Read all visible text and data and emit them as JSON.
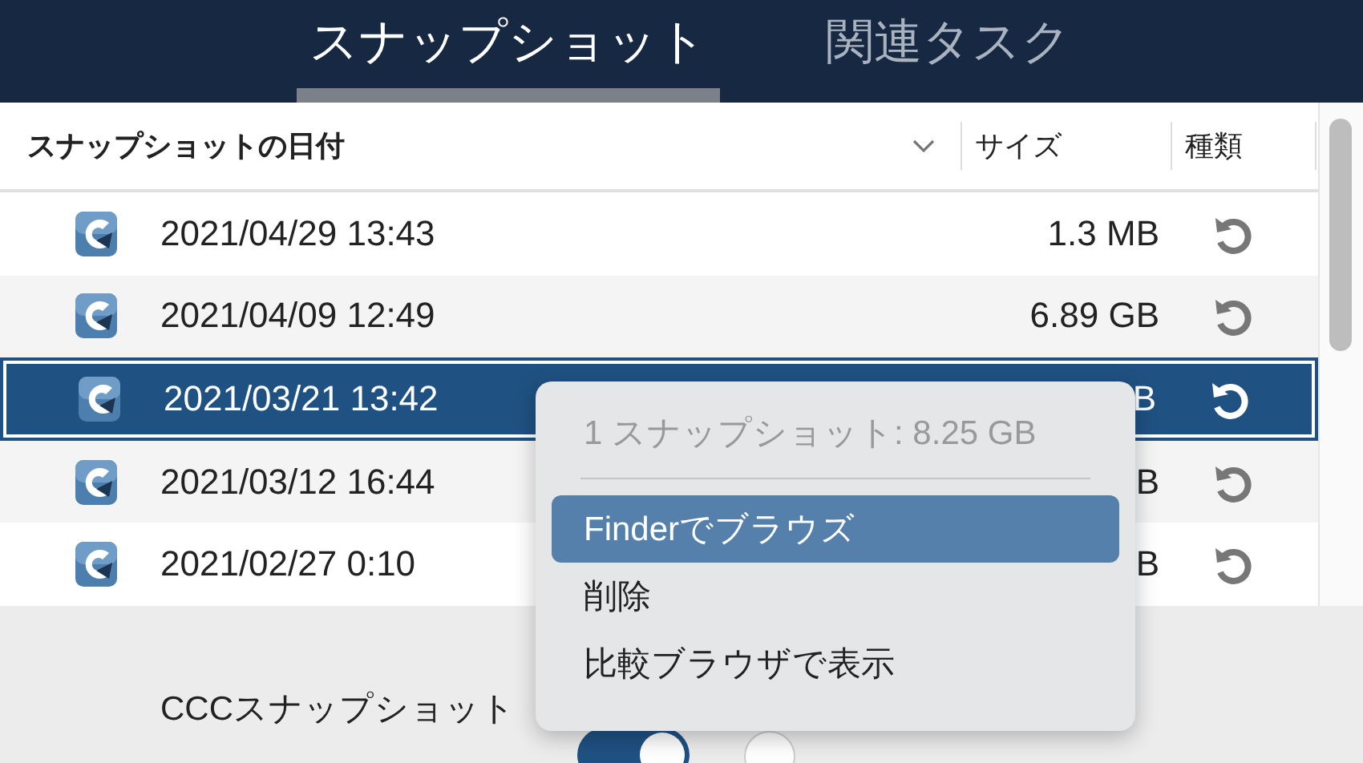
{
  "tabs": [
    {
      "label": "スナップショット",
      "selected": true
    },
    {
      "label": "関連タスク",
      "selected": false
    }
  ],
  "table": {
    "columns": [
      {
        "label": "スナップショットの日付",
        "sorted": true
      },
      {
        "label": "サイズ"
      },
      {
        "label": "種類"
      }
    ],
    "rows": [
      {
        "date": "2021/04/29 13:43",
        "size": "1.3 MB",
        "selected": false
      },
      {
        "date": "2021/04/09 12:49",
        "size": "6.89 GB",
        "selected": false
      },
      {
        "date": "2021/03/21 13:42",
        "size": "B",
        "selected": true
      },
      {
        "date": "2021/03/12 16:44",
        "size": "B",
        "selected": false
      },
      {
        "date": "2021/02/27 0:10",
        "size": "B",
        "selected": false
      }
    ]
  },
  "settings": {
    "label": "CCCスナップショット",
    "toggle_on": true
  },
  "context_menu": {
    "header": "1 スナップショット: 8.25 GB",
    "items": [
      {
        "label": "Finderでブラウズ",
        "selected": true
      },
      {
        "label": "削除",
        "selected": false
      },
      {
        "label": "比較ブラウザで表示",
        "selected": false
      }
    ]
  }
}
